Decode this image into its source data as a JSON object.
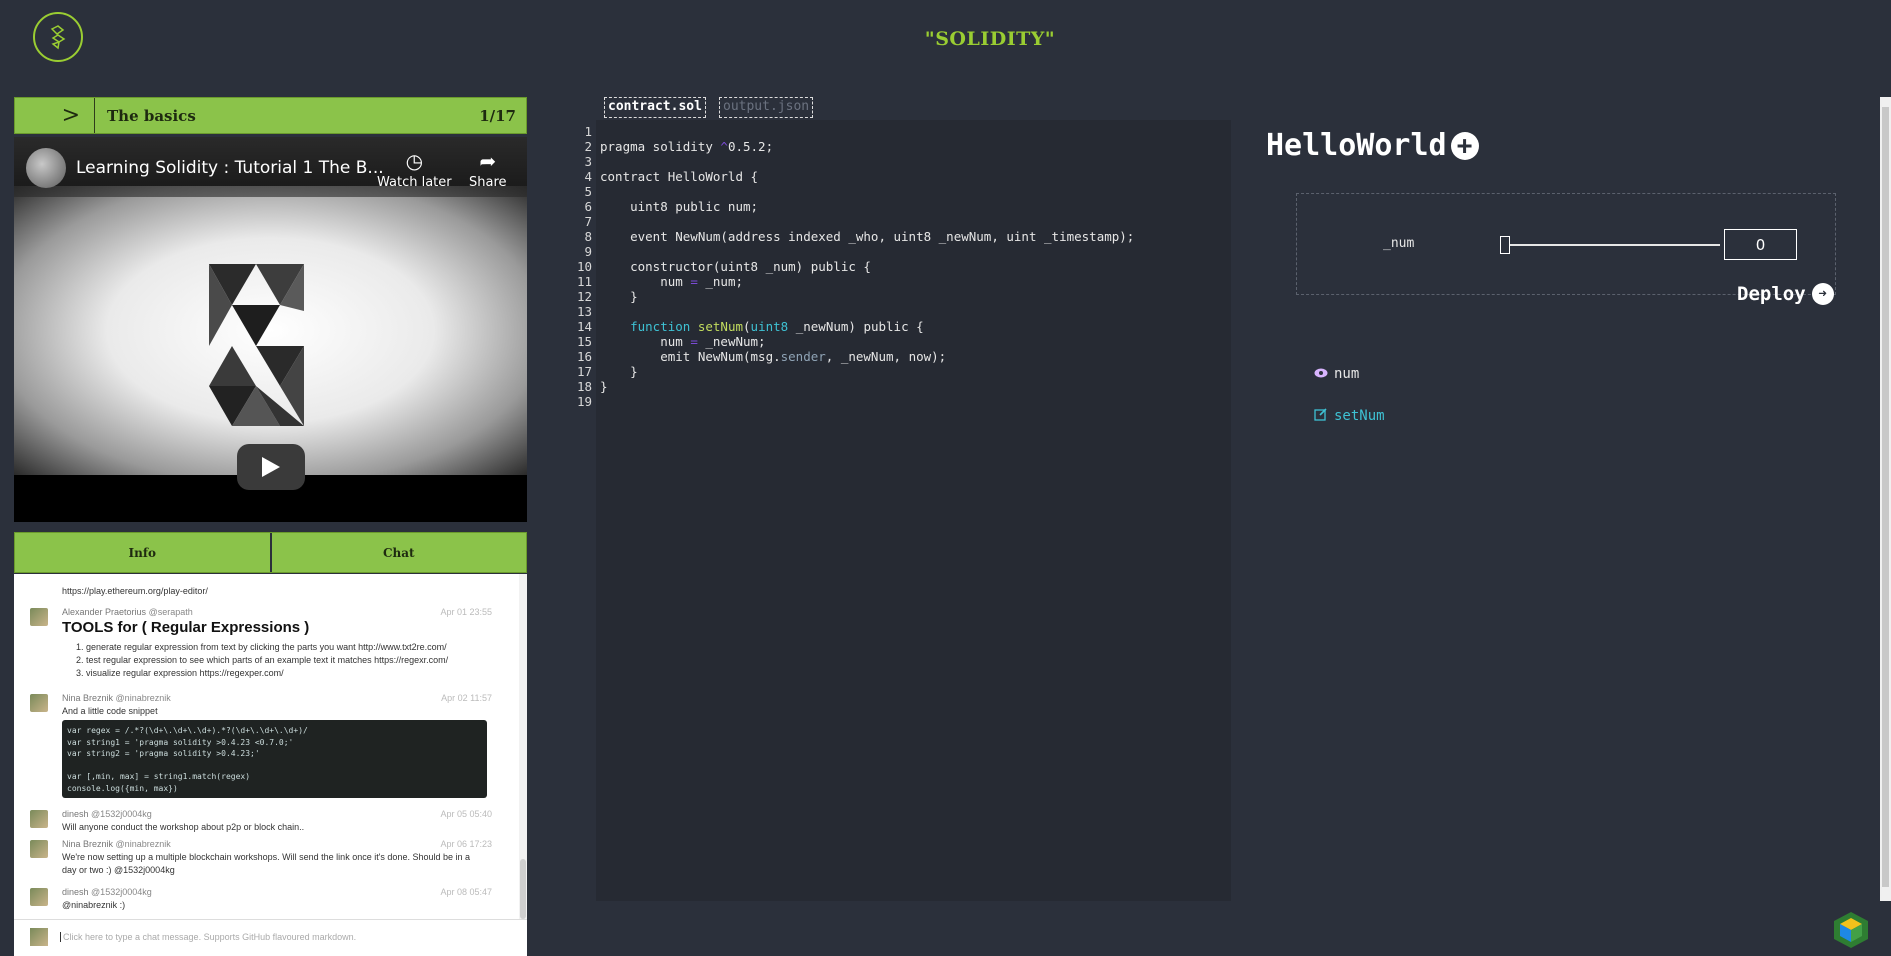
{
  "header": {
    "title": "\"SOLIDITY\""
  },
  "lesson": {
    "toggle": ">",
    "title": "The basics",
    "progress": "1/17"
  },
  "video": {
    "title": "Learning Solidity : Tutorial 1 The B...",
    "watch_later": "Watch later",
    "share": "Share"
  },
  "panel_tabs": {
    "info": "Info",
    "chat": "Chat"
  },
  "chat": {
    "top_link": "https://play.ethereum.org/play-editor/",
    "messages": [
      {
        "author": "Alexander Praetorius",
        "handle": "@serapath",
        "time": "Apr 01 23:55",
        "heading": "TOOLS for ( Regular Expressions )",
        "items": [
          "1. generate regular expression from text by clicking the parts you want http://www.txt2re.com/",
          "2. test regular expression to see which parts of an example text it matches https://regexr.com/",
          "3. visualize regular expression https://regexper.com/"
        ]
      },
      {
        "author": "Nina Breznik",
        "handle": "@ninabreznik",
        "time": "Apr 02 11:57",
        "text": "And a little code snippet",
        "code": [
          "var regex = /.*?(\\d+\\.\\d+\\.\\d+).*?(\\d+\\.\\d+\\.\\d+)/",
          "var string1 = 'pragma solidity >0.4.23 <0.7.0;'",
          "var string2 = 'pragma solidity >0.4.23;'",
          "",
          "var [,min, max] = string1.match(regex)",
          "console.log({min, max})"
        ]
      },
      {
        "author": "dinesh",
        "handle": "@1532j0004kg",
        "time": "Apr 05 05:40",
        "text": "Will anyone conduct the workshop about p2p or block chain.."
      },
      {
        "author": "Nina Breznik",
        "handle": "@ninabreznik",
        "time": "Apr 06 17:23",
        "text": "We're now setting up a multiple blockchain workshops. Will send the link once it's done. Should be in a day or two :) @1532j0004kg"
      },
      {
        "author": "dinesh",
        "handle": "@1532j0004kg",
        "time": "Apr 08 05:47",
        "text": "@ninabreznik :)"
      }
    ],
    "input_placeholder": "Click here to type a chat message. Supports GitHub flavoured markdown."
  },
  "editor": {
    "tabs": [
      "contract.sol",
      "output.json"
    ],
    "lines": [
      "",
      "pragma solidity ^0.5.2;",
      "",
      "contract HelloWorld {",
      "",
      "    uint8 public num;",
      "",
      "    event NewNum(address indexed _who, uint8 _newNum, uint _timestamp);",
      "",
      "    constructor(uint8 _num) public {",
      "        num = _num;",
      "    }",
      "",
      "    function setNum(uint8 _newNum) public {",
      "        num = _newNum;",
      "        emit NewNum(msg.sender, _newNum, now);",
      "    }",
      "}",
      ""
    ]
  },
  "contract": {
    "name": "HelloWorld",
    "param_label": "_num",
    "param_value": "0",
    "slider_fraction": 0,
    "deploy_label": "Deploy",
    "functions": [
      {
        "name": "num",
        "icon": "eye-icon"
      },
      {
        "name": "setNum",
        "icon": "edit-icon"
      }
    ]
  },
  "colors": {
    "accent": "#8bc34a",
    "title": "#9acd32",
    "background": "#2b303b",
    "editor": "#262a33",
    "function": "#3ec1d3"
  }
}
